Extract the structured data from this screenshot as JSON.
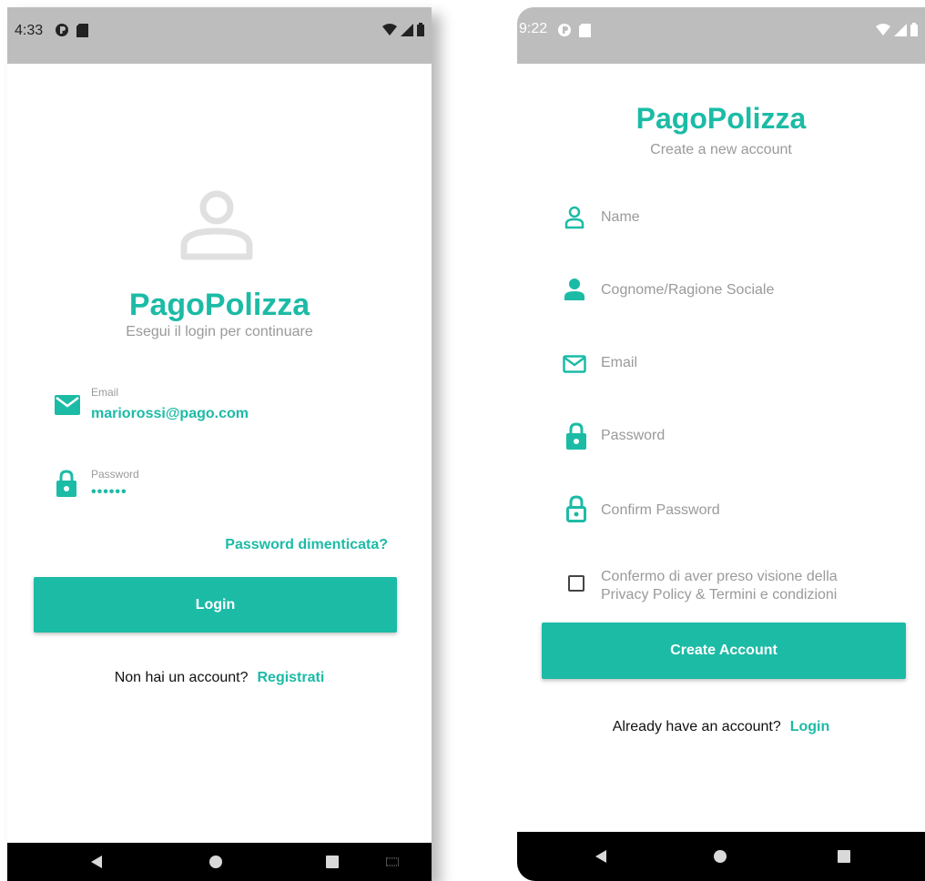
{
  "login_screen": {
    "status_bar": {
      "time": "4:33"
    },
    "brand": {
      "title": "PagoPolizza",
      "subtitle": "Esegui il login per continuare"
    },
    "email": {
      "label": "Email",
      "value": "mariorossi@pago.com"
    },
    "password": {
      "label": "Password",
      "value": "••••••"
    },
    "forgot_password": "Password dimenticata?",
    "login_button": "Login",
    "footer": {
      "text": "Non hai un account?",
      "link": "Registrati"
    }
  },
  "register_screen": {
    "status_bar": {
      "time": "9:22"
    },
    "brand": {
      "title": "PagoPolizza",
      "subtitle": "Create a new account"
    },
    "fields": {
      "name": "Name",
      "surname": "Cognome/Ragione Sociale",
      "email": "Email",
      "password": "Password",
      "confirm_password": "Confirm Password"
    },
    "consent": {
      "line1": "Confermo di aver preso visione della",
      "line2": "Privacy Policy & Termini e condizioni",
      "checked": false
    },
    "create_button": "Create Account",
    "footer": {
      "text": "Already have an account?",
      "link": "Login"
    }
  },
  "colors": {
    "accent": "#1cbba6",
    "muted": "#9a9a9a",
    "status_bar": "#bdbdbd",
    "nav_bar": "#000000"
  },
  "icons": [
    "person-outline-icon",
    "person-filled-icon",
    "mail-icon",
    "lock-icon",
    "lock-outline-icon",
    "wifi-icon",
    "signal-icon",
    "battery-icon",
    "sdcard-icon",
    "notification-icon"
  ]
}
